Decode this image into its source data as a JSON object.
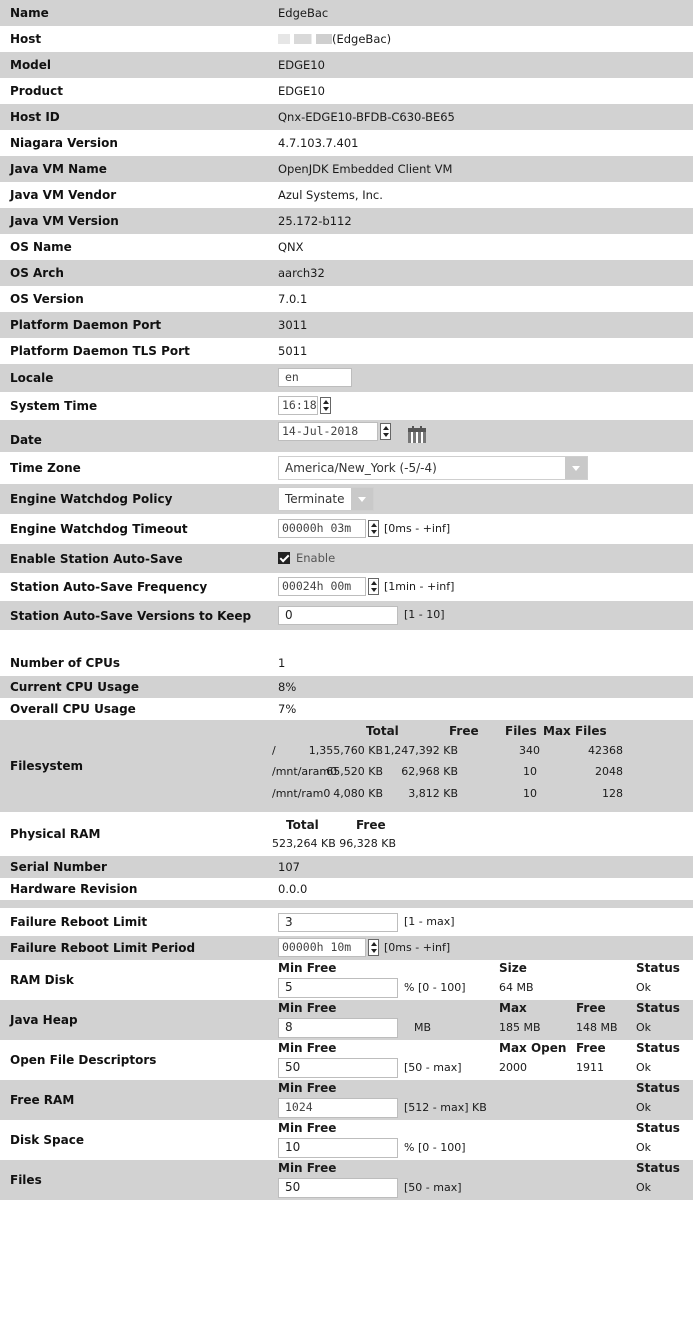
{
  "info": {
    "name": {
      "label": "Name",
      "value": "EdgeBac"
    },
    "host": {
      "label": "Host",
      "value": "(EdgeBac)"
    },
    "model": {
      "label": "Model",
      "value": "EDGE10"
    },
    "product": {
      "label": "Product",
      "value": "EDGE10"
    },
    "host_id": {
      "label": "Host ID",
      "value": "Qnx-EDGE10-BFDB-C630-BE65"
    },
    "niagara_version": {
      "label": "Niagara Version",
      "value": "4.7.103.7.401"
    },
    "jvm_name": {
      "label": "Java VM Name",
      "value": "OpenJDK Embedded Client VM"
    },
    "jvm_vendor": {
      "label": "Java VM Vendor",
      "value": "Azul Systems, Inc."
    },
    "jvm_version": {
      "label": "Java VM Version",
      "value": "25.172-b112"
    },
    "os_name": {
      "label": "OS Name",
      "value": "QNX"
    },
    "os_arch": {
      "label": "OS Arch",
      "value": "aarch32"
    },
    "os_version": {
      "label": "OS Version",
      "value": "7.0.1"
    },
    "daemon_port": {
      "label": "Platform Daemon Port",
      "value": "3011"
    },
    "daemon_tls_port": {
      "label": "Platform Daemon TLS Port",
      "value": "5011"
    }
  },
  "settings": {
    "locale": {
      "label": "Locale",
      "value": "en"
    },
    "system_time": {
      "label": "System Time",
      "value": "16:18"
    },
    "date": {
      "label": "Date",
      "value": "14-Jul-2018"
    },
    "time_zone": {
      "label": "Time Zone",
      "value": "America/New_York (-5/-4)"
    },
    "watchdog_policy": {
      "label": "Engine Watchdog Policy",
      "value": "Terminate"
    },
    "watchdog_timeout": {
      "label": "Engine Watchdog Timeout",
      "value": "00000h 03m",
      "range": "[0ms - +inf]"
    },
    "auto_save": {
      "label": "Enable Station Auto-Save",
      "value": "Enable"
    },
    "auto_save_freq": {
      "label": "Station Auto-Save Frequency",
      "value": "00024h 00m",
      "range": "[1min - +inf]"
    },
    "auto_save_versions": {
      "label": "Station Auto-Save Versions to Keep",
      "value": "0",
      "range": "[1 - 10]"
    }
  },
  "system": {
    "cpus": {
      "label": "Number of CPUs",
      "value": "1"
    },
    "cpu_usage": {
      "label": "Current CPU Usage",
      "value": "8%"
    },
    "overall_cpu": {
      "label": "Overall CPU Usage",
      "value": "7%"
    },
    "filesystem": {
      "label": "Filesystem",
      "headers": [
        "Total",
        "Free",
        "Files",
        "Max Files"
      ],
      "rows": [
        {
          "path": "/",
          "total": "1,355,760 KB",
          "free": "1,247,392 KB",
          "files": "340",
          "max": "42368"
        },
        {
          "path": "/mnt/aram0",
          "total": "65,520 KB",
          "free": "62,968 KB",
          "files": "10",
          "max": "2048"
        },
        {
          "path": "/mnt/ram0",
          "total": "4,080 KB",
          "free": "3,812 KB",
          "files": "10",
          "max": "128"
        }
      ]
    },
    "ram": {
      "label": "Physical RAM",
      "h_total": "Total",
      "h_free": "Free",
      "value": "523,264 KB 96,328 KB"
    },
    "serial": {
      "label": "Serial Number",
      "value": "107"
    },
    "hw_rev": {
      "label": "Hardware Revision",
      "value": "0.0.0"
    }
  },
  "limits": {
    "reboot_limit": {
      "label": "Failure Reboot Limit",
      "value": "3",
      "range": "[1 - max]"
    },
    "reboot_period": {
      "label": "Failure Reboot Limit Period",
      "value": "00000h 10m",
      "range": "[0ms - +inf]"
    },
    "h_min_free": "Min Free",
    "h_status": "Status",
    "ram_disk": {
      "label": "RAM Disk",
      "value": "5",
      "unit": "% [0 - 100]",
      "h_size": "Size",
      "size": "64 MB",
      "status": "Ok"
    },
    "java_heap": {
      "label": "Java Heap",
      "value": "8",
      "unit": "MB",
      "h_max": "Max",
      "max": "185 MB",
      "h_free": "Free",
      "free": "148 MB",
      "status": "Ok"
    },
    "file_desc": {
      "label": "Open File Descriptors",
      "value": "50",
      "unit": "[50 - max]",
      "h_max": "Max Open",
      "max": "2000",
      "h_free": "Free",
      "free": "1911",
      "status": "Ok"
    },
    "free_ram": {
      "label": "Free RAM",
      "value": "1024",
      "unit": "[512 - max] KB",
      "status": "Ok"
    },
    "disk_space": {
      "label": "Disk Space",
      "value": "10",
      "unit": "% [0 - 100]",
      "status": "Ok"
    },
    "files": {
      "label": "Files",
      "value": "50",
      "unit": "[50 - max]",
      "status": "Ok"
    }
  }
}
